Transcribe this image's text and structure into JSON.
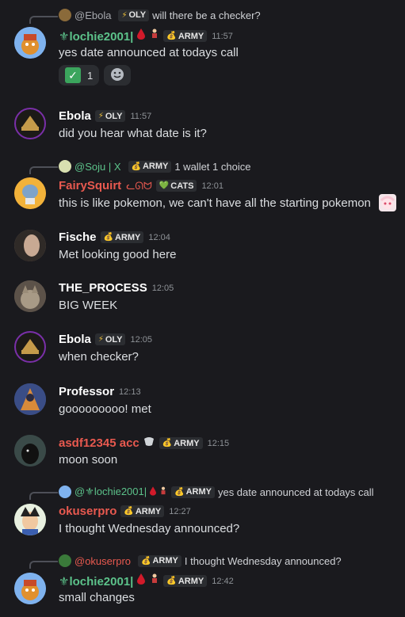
{
  "messages": [
    {
      "reply": {
        "author": "@Ebola",
        "tag_icon": "⚡",
        "tag": "OLY",
        "text": "will there be a checker?"
      },
      "author": "⚜lochie2001|",
      "author_color": "#5cc28a",
      "tag": "ARMY",
      "time": "11:57",
      "text": "yes date announced at todays call",
      "reactions": {
        "check_count": "1"
      }
    },
    {
      "author": "Ebola",
      "author_color": "#ffffff",
      "tag_icon": "⚡",
      "tag": "OLY",
      "time": "11:57",
      "text": "did you hear what date is it?"
    },
    {
      "reply": {
        "author": "@Soju | X",
        "tag": "ARMY",
        "text": "1 wallet 1 choice"
      },
      "author": "FairySquirt",
      "author_suffix": "ᓚᘏᗢ",
      "author_color": "#e8594f",
      "tag_icon": "💚",
      "tag": "CATS",
      "time": "12:01",
      "text": "this is like pokemon, we can't have all the starting pokemon"
    },
    {
      "author": "Fische",
      "author_color": "#ffffff",
      "tag": "ARMY",
      "time": "12:04",
      "text": "Met looking good here"
    },
    {
      "author": "THE_PROCESS",
      "author_color": "#ffffff",
      "time": "12:05",
      "text": "BIG WEEK"
    },
    {
      "author": "Ebola",
      "author_color": "#ffffff",
      "tag_icon": "⚡",
      "tag": "OLY",
      "time": "12:05",
      "text": "when checker?"
    },
    {
      "author": "Professor",
      "author_color": "#ffffff",
      "time": "12:13",
      "text": "gooooooooo! met"
    },
    {
      "author": "asdf12345 acc",
      "author_color": "#e8594f",
      "tag": "ARMY",
      "time": "12:15",
      "text": "moon soon"
    },
    {
      "reply": {
        "author": "@⚜lochie2001|",
        "tag": "ARMY",
        "text": "yes date announced at todays call"
      },
      "author": "okuserpro",
      "author_color": "#e8594f",
      "tag": "ARMY",
      "time": "12:27",
      "text": "I thought Wednesday announced?"
    },
    {
      "reply": {
        "author": "@okuserpro",
        "tag": "ARMY",
        "text": "I thought Wednesday announced?"
      },
      "author": "⚜lochie2001|",
      "author_color": "#5cc28a",
      "tag": "ARMY",
      "time": "12:42",
      "text": "small changes"
    }
  ],
  "colors": {
    "background": "#1a1a1e",
    "timestamp": "#8e9297",
    "tag_bg": "#2b2d31"
  }
}
